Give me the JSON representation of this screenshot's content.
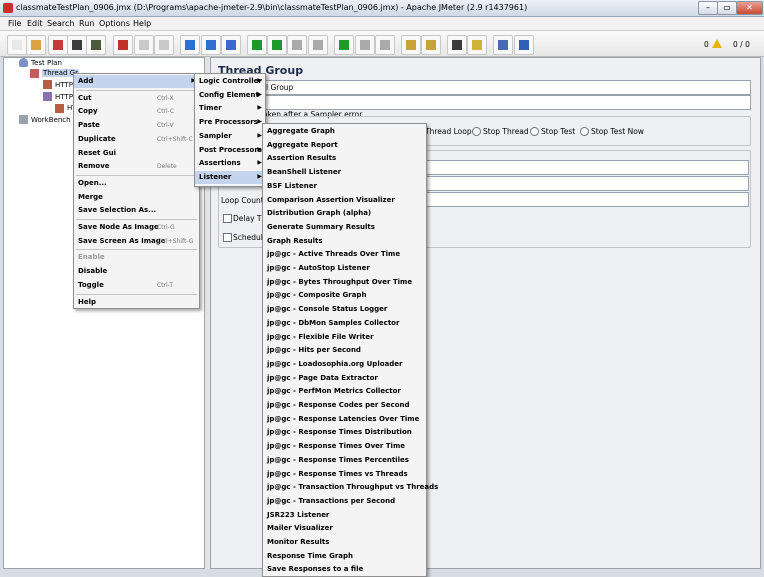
{
  "window": {
    "title": "classmateTestPlan_0906.jmx (D:\\Programs\\apache-jmeter-2.9\\bin\\classmateTestPlan_0906.jmx) - Apache JMeter (2.9 r1437961)",
    "minimize": "–",
    "maximize": "▭",
    "close": "✕"
  },
  "menubar": [
    "File",
    "Edit",
    "Search",
    "Run",
    "Options",
    "Help"
  ],
  "toolbar": {
    "icons": [
      "new-icon",
      "open-icon",
      "close-icon",
      "save-icon",
      "save-as-icon",
      "cut-icon",
      "copy-icon",
      "paste-icon",
      "expand-icon",
      "collapse-icon",
      "toggle-icon",
      "start-icon",
      "start-no-pause-icon",
      "stop-icon",
      "shutdown-icon",
      "remote-start-icon",
      "remote-stop-icon",
      "remote-shutdown-icon",
      "clear-icon",
      "clear-all-icon",
      "search-icon",
      "reset-search-icon",
      "function-helper-icon",
      "help-icon"
    ],
    "warnings": "0",
    "threads": "0 / 0"
  },
  "tree": {
    "test_plan": "Test Plan",
    "thread_group": "Thread Gr",
    "children": [
      "HTTP",
      "HTTP",
      "HT"
    ],
    "workbench": "WorkBench"
  },
  "panel": {
    "title": "Thread Group",
    "name_value": "l Group",
    "error_action_label": "aken after a Sampler error",
    "radio_opts": [
      "Thread Loop",
      "Stop Thread",
      "Stop Test",
      "Stop Test Now"
    ],
    "loop_count_label": "Loop Count:",
    "delay_label": "Delay Thr",
    "scheduler_label": "Schedule"
  },
  "context_menu": {
    "items": [
      {
        "label": "Add",
        "shortcut": "",
        "submenu": true,
        "highlight": true
      },
      {
        "sep": true
      },
      {
        "label": "Cut",
        "shortcut": "Ctrl-X"
      },
      {
        "label": "Copy",
        "shortcut": "Ctrl-C"
      },
      {
        "label": "Paste",
        "shortcut": "Ctrl-V"
      },
      {
        "label": "Duplicate",
        "shortcut": "Ctrl+Shift-C"
      },
      {
        "label": "Reset Gui",
        "shortcut": ""
      },
      {
        "label": "Remove",
        "shortcut": "Delete"
      },
      {
        "sep": true
      },
      {
        "label": "Open...",
        "shortcut": ""
      },
      {
        "label": "Merge",
        "shortcut": ""
      },
      {
        "label": "Save Selection As...",
        "shortcut": ""
      },
      {
        "sep": true
      },
      {
        "label": "Save Node As Image",
        "shortcut": "Ctrl-G"
      },
      {
        "label": "Save Screen As Image",
        "shortcut": "Ctrl+Shift-G"
      },
      {
        "sep": true
      },
      {
        "label": "Enable",
        "shortcut": "",
        "disabled": true
      },
      {
        "label": "Disable",
        "shortcut": ""
      },
      {
        "label": "Toggle",
        "shortcut": "Ctrl-T"
      },
      {
        "sep": true
      },
      {
        "label": "Help",
        "shortcut": ""
      }
    ]
  },
  "add_submenu": {
    "items": [
      {
        "label": "Logic Controller"
      },
      {
        "label": "Config Element"
      },
      {
        "label": "Timer"
      },
      {
        "label": "Pre Processors"
      },
      {
        "label": "Sampler"
      },
      {
        "label": "Post Processors"
      },
      {
        "label": "Assertions"
      },
      {
        "label": "Listener",
        "highlight": true
      }
    ]
  },
  "listener_submenu": {
    "items": [
      "Aggregate Graph",
      "Aggregate Report",
      "Assertion Results",
      "BeanShell Listener",
      "BSF Listener",
      "Comparison Assertion Visualizer",
      "Distribution Graph (alpha)",
      "Generate Summary Results",
      "Graph Results",
      "jp@gc - Active Threads Over Time",
      "jp@gc - AutoStop Listener",
      "jp@gc - Bytes Throughput Over Time",
      "jp@gc - Composite Graph",
      "jp@gc - Console Status Logger",
      "jp@gc - DbMon Samples Collector",
      "jp@gc - Flexible File Writer",
      "jp@gc - Hits per Second",
      "jp@gc - Loadosophia.org Uploader",
      "jp@gc - Page Data Extractor",
      "jp@gc - PerfMon Metrics Collector",
      "jp@gc - Response Codes per Second",
      "jp@gc - Response Latencies Over Time",
      "jp@gc - Response Times Distribution",
      "jp@gc - Response Times Over Time",
      "jp@gc - Response Times Percentiles",
      "jp@gc - Response Times vs Threads",
      "jp@gc - Transaction Throughput vs Threads",
      "jp@gc - Transactions per Second",
      "JSR223 Listener",
      "Mailer Visualizer",
      "Monitor Results",
      "Response Time Graph",
      "Save Responses to a file"
    ]
  }
}
